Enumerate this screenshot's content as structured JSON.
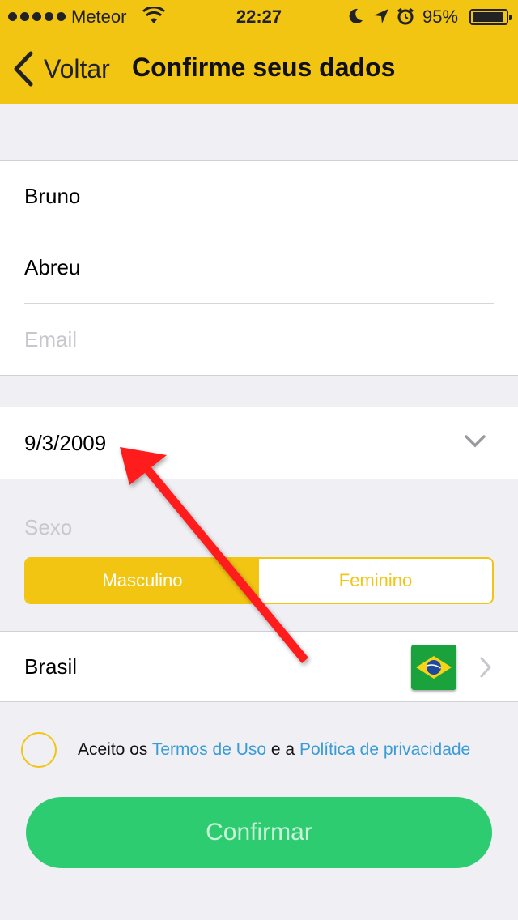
{
  "status_bar": {
    "carrier": "Meteor",
    "time": "22:27",
    "battery_pct": "95%"
  },
  "nav": {
    "back_label": "Voltar",
    "title": "Confirme seus dados"
  },
  "form": {
    "first_name": "Bruno",
    "last_name": "Abreu",
    "email_placeholder": "Email",
    "birth_date": "9/3/2009",
    "sexo_label": "Sexo",
    "sexo_options": [
      "Masculino",
      "Feminino"
    ],
    "sexo_selected": "Masculino",
    "country": "Brasil"
  },
  "terms": {
    "prefix": "Aceito os ",
    "link1": "Termos de Uso",
    "middle": " e a ",
    "link2": "Política de privacidade",
    "checked": false
  },
  "confirm_label": "Confirmar",
  "colors": {
    "accent": "#f2c513",
    "confirm": "#2ecc71",
    "link": "#3a9bd5",
    "annotation_arrow": "#ff1a1a"
  },
  "icons": [
    "back-chevron-icon",
    "wifi-icon",
    "moon-icon",
    "location-icon",
    "alarm-icon",
    "battery-icon",
    "chevron-down-icon",
    "brazil-flag-icon",
    "chevron-right-icon",
    "annotation-arrow"
  ]
}
